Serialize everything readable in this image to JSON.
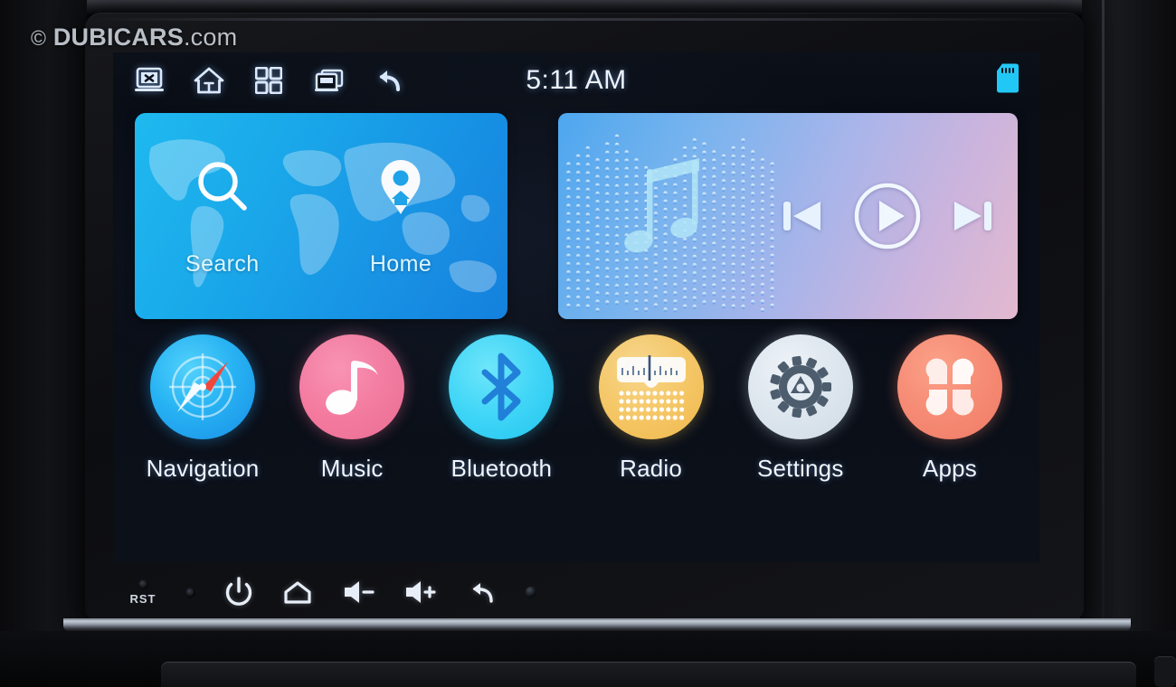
{
  "watermark": {
    "copyright": "©",
    "brand": "DUBICARS",
    "tld": ".com"
  },
  "status_bar": {
    "clock": "5:11 AM",
    "icons": [
      {
        "name": "screen-off-icon",
        "label": "Screen Off"
      },
      {
        "name": "home-icon",
        "label": "Home"
      },
      {
        "name": "apps-grid-icon",
        "label": "All Apps"
      },
      {
        "name": "recents-icon",
        "label": "Recent Tasks"
      },
      {
        "name": "back-icon",
        "label": "Back"
      }
    ],
    "sd_card": {
      "name": "sd-card-icon",
      "label": "SD Card",
      "color": "#22c8f5"
    }
  },
  "nav_widget": {
    "name": "navigation-widget",
    "background": "world-map",
    "accent": "#17a8ea",
    "tiles": [
      {
        "name": "search-tile",
        "icon": "search-icon",
        "label": "Search"
      },
      {
        "name": "home-tile",
        "icon": "map-pin-home-icon",
        "label": "Home"
      }
    ]
  },
  "music_widget": {
    "name": "music-widget",
    "artwork": "equalizer-music-note",
    "gradient_from": "#4ca7ef",
    "gradient_to": "#e3b9cf",
    "controls": [
      {
        "name": "previous-track-button",
        "icon": "skip-previous-icon",
        "label": "Previous"
      },
      {
        "name": "play-button",
        "icon": "play-circle-icon",
        "label": "Play"
      },
      {
        "name": "next-track-button",
        "icon": "skip-next-icon",
        "label": "Next"
      }
    ]
  },
  "apps": [
    {
      "name": "app-navigation",
      "label": "Navigation",
      "icon": "compass-icon",
      "color": "#27b3f3"
    },
    {
      "name": "app-music",
      "label": "Music",
      "icon": "music-note-icon",
      "color": "#f47b9f"
    },
    {
      "name": "app-bluetooth",
      "label": "Bluetooth",
      "icon": "bluetooth-icon",
      "color": "#3fd6f7"
    },
    {
      "name": "app-radio",
      "label": "Radio",
      "icon": "radio-icon",
      "color": "#f6c765"
    },
    {
      "name": "app-settings",
      "label": "Settings",
      "icon": "gear-icon",
      "color": "#dde6ee"
    },
    {
      "name": "app-apps",
      "label": "Apps",
      "icon": "clover-grid-icon",
      "color": "#f68b74"
    }
  ],
  "hardware_keys": {
    "reset_label": "RST",
    "keys": [
      {
        "name": "reset-pinhole",
        "icon": "pinhole-icon",
        "label": "RST"
      },
      {
        "name": "indicator-led",
        "icon": "led-icon",
        "label": ""
      },
      {
        "name": "power-key",
        "icon": "power-icon",
        "label": "Power"
      },
      {
        "name": "home-key",
        "icon": "home-outline-icon",
        "label": "Home"
      },
      {
        "name": "volume-down-key",
        "icon": "volume-down-icon",
        "label": "Volume Down"
      },
      {
        "name": "volume-up-key",
        "icon": "volume-up-icon",
        "label": "Volume Up"
      },
      {
        "name": "back-key",
        "icon": "back-arrow-icon",
        "label": "Back"
      },
      {
        "name": "microphone",
        "icon": "mic-dot-icon",
        "label": ""
      }
    ]
  }
}
